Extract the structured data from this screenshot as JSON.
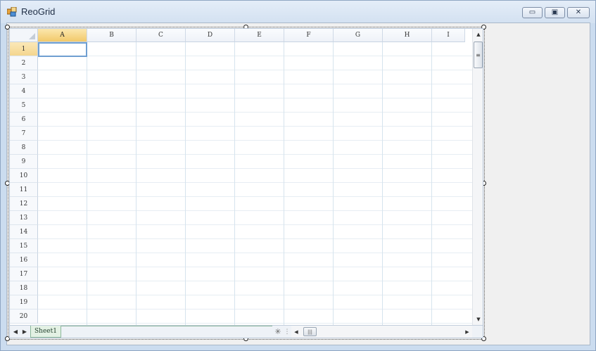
{
  "window": {
    "title": "ReoGrid",
    "min_label": "▭",
    "max_label": "▣",
    "close_label": "✕",
    "accent": "#f2c96a",
    "selection_color": "#6f9fd1"
  },
  "icons": {
    "app": "app-icon",
    "add_sheet": "✳",
    "nav_left": "◀",
    "nav_right": "▶",
    "scroll_up": "▲",
    "scroll_down": "▼",
    "scroll_left": "◀",
    "scroll_right": "▶",
    "vgrip": "≡",
    "hgrip": "|||",
    "splitter": "⋮"
  },
  "grid": {
    "columns": [
      "A",
      "B",
      "C",
      "D",
      "E",
      "F",
      "G",
      "H",
      "I"
    ],
    "rows": [
      "1",
      "2",
      "3",
      "4",
      "5",
      "6",
      "7",
      "8",
      "9",
      "10",
      "11",
      "12",
      "13",
      "14",
      "15",
      "16",
      "17",
      "18",
      "19",
      "20"
    ],
    "active_column": "A",
    "active_row": "1"
  },
  "sheets": [
    {
      "name": "Sheet1",
      "active": true
    }
  ]
}
